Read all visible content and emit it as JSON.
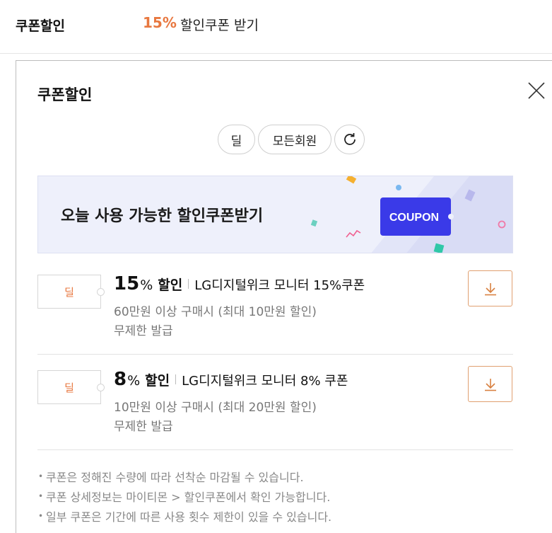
{
  "top": {
    "label": "쿠폰할인",
    "percent": "15%",
    "text": "할인쿠폰 받기"
  },
  "panel": {
    "title": "쿠폰할인",
    "filters": [
      "딜",
      "모든회원"
    ],
    "banner_text": "오늘 사용 가능한 할인쿠폰받기",
    "banner_badge": "COUPON",
    "coupons": [
      {
        "type": "딜",
        "amount": "15",
        "unit": "%",
        "sale": "할인",
        "name": "LG디지털위크 모니터 15%쿠폰",
        "condition": "60만원 이상 구매시 (최대 10만원 할인)",
        "issue": "무제한 발급"
      },
      {
        "type": "딜",
        "amount": "8",
        "unit": "%",
        "sale": "할인",
        "name": "LG디지털위크 모니터 8% 쿠폰",
        "condition": "10만원 이상 구매시 (최대 20만원 할인)",
        "issue": "무제한 발급"
      }
    ],
    "notes": [
      "쿠폰은 정해진 수량에 따라 선착순 마감될 수 있습니다.",
      "쿠폰 상세정보는 마이티몬 > 할인쿠폰에서 확인 가능합니다.",
      "일부 쿠폰은 기간에 따른 사용 횟수 제한이 있을 수 있습니다."
    ]
  },
  "colors": {
    "accent": "#e87840",
    "coupon_blue": "#3a3ae8",
    "banner_bg": "#eef0fb"
  },
  "icons": {
    "close": "close-icon",
    "refresh": "refresh-icon",
    "download": "download-icon"
  }
}
